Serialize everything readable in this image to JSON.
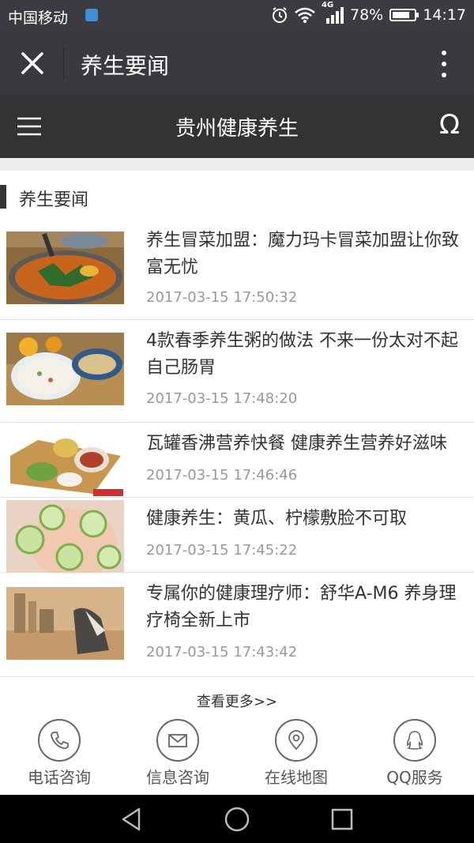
{
  "status_bar": {
    "carrier": "中国移动",
    "network": "4G",
    "battery": "78%",
    "battery_level": 0.78,
    "time": "14:17"
  },
  "title_bar": {
    "title": "养生要闻"
  },
  "site_header": {
    "title": "贵州健康养生"
  },
  "section": {
    "title": "养生要闻"
  },
  "news": [
    {
      "title": "养生冒菜加盟：魔力玛卡冒菜加盟让你致富无忧",
      "time": "2017-03-15 17:50:32",
      "image": "maocai-bowl"
    },
    {
      "title": "4款春季养生粥的做法 不来一份太对不起自己肠胃",
      "time": "2017-03-15 17:48:20",
      "image": "porridge-bowls"
    },
    {
      "title": "瓦罐香沸营养快餐 健康养生营养好滋味",
      "time": "2017-03-15 17:46:46",
      "image": "fast-food-tray"
    },
    {
      "title": "健康养生：黄瓜、柠檬敷脸不可取",
      "time": "2017-03-15 17:45:22",
      "image": "cucumber-face-mask"
    },
    {
      "title": "专属你的健康理疗师：舒华A-M6 养身理疗椅全新上市",
      "time": "2017-03-15 17:43:42",
      "image": "massage-chair"
    }
  ],
  "more_link": "查看更多>>",
  "bottom_bar": [
    {
      "label": "电话咨询",
      "icon": "phone-icon"
    },
    {
      "label": "信息咨询",
      "icon": "mail-icon"
    },
    {
      "label": "在线地图",
      "icon": "map-pin-icon"
    },
    {
      "label": "QQ服务",
      "icon": "qq-icon"
    }
  ],
  "colors": {
    "status_bar": "#3b3c3f",
    "title_bar": "#393a3f",
    "site_header": "#333333",
    "nav_bar": "#000000"
  }
}
